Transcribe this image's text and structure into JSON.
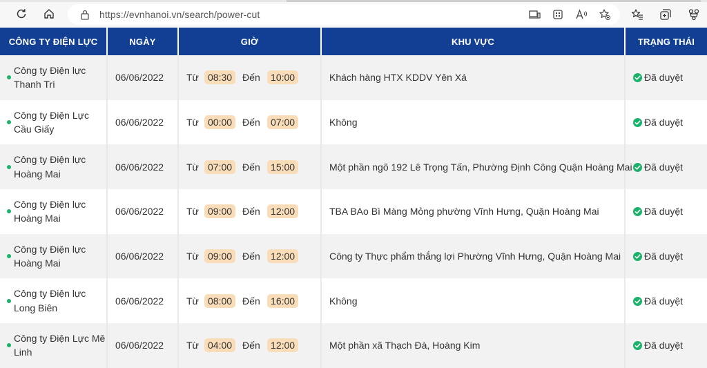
{
  "browser": {
    "url": "https://evnhanoi.vn/search/power-cut",
    "icons": [
      "refresh-icon",
      "home-icon",
      "lock-icon",
      "read-view-icon",
      "apps-icon",
      "read-aloud-icon",
      "favorite-add-icon",
      "favorites-icon",
      "collections-icon",
      "extensions-icon"
    ]
  },
  "table": {
    "headers": {
      "company": "CÔNG TY ĐIỆN LỰC",
      "date": "NGÀY",
      "time": "GIỜ",
      "area": "KHU VỰC",
      "status": "TRẠNG THÁI"
    },
    "from_label": "Từ",
    "to_label": "Đến",
    "rows": [
      {
        "company_line1": "Công ty Điện lực",
        "company_line2": "Thanh Trì",
        "date": "06/06/2022",
        "from": "08:30",
        "to": "10:00",
        "area": "Khách hàng HTX KDDV Yên Xá",
        "status": "Đã duyệt"
      },
      {
        "company_line1": "Công ty Điện Lực",
        "company_line2": "Cầu Giấy",
        "date": "06/06/2022",
        "from": "00:00",
        "to": "07:00",
        "area": "Không",
        "status": "Đã duyệt"
      },
      {
        "company_line1": "Công ty Điện lực",
        "company_line2": "Hoàng Mai",
        "date": "06/06/2022",
        "from": "07:00",
        "to": "15:00",
        "area": "Một phần ngõ 192 Lê Trọng Tấn, Phường Định Công Quận Hoàng Mai",
        "status": "Đã duyệt"
      },
      {
        "company_line1": "Công ty Điện lực",
        "company_line2": "Hoàng Mai",
        "date": "06/06/2022",
        "from": "09:00",
        "to": "12:00",
        "area": "TBA BAo Bì Màng Mỏng phường Vĩnh Hưng, Quận Hoàng Mai",
        "status": "Đã duyệt"
      },
      {
        "company_line1": "Công ty Điện lực",
        "company_line2": "Hoàng Mai",
        "date": "06/06/2022",
        "from": "09:00",
        "to": "12:00",
        "area": "Công ty Thực phẩm thắng lợi Phường Vĩnh Hưng, Quận Hoàng Mai",
        "status": "Đã duyệt"
      },
      {
        "company_line1": "Công ty Điện lực",
        "company_line2": "Long Biên",
        "date": "06/06/2022",
        "from": "08:00",
        "to": "16:00",
        "area": "Không",
        "status": "Đã duyệt"
      },
      {
        "company_line1": "Công ty Điện Lực Mê",
        "company_line2": "Linh",
        "date": "06/06/2022",
        "from": "04:00",
        "to": "12:00",
        "area": "Một phần xã Thạch Đà, Hoàng Kim",
        "status": "Đã duyệt"
      }
    ]
  }
}
